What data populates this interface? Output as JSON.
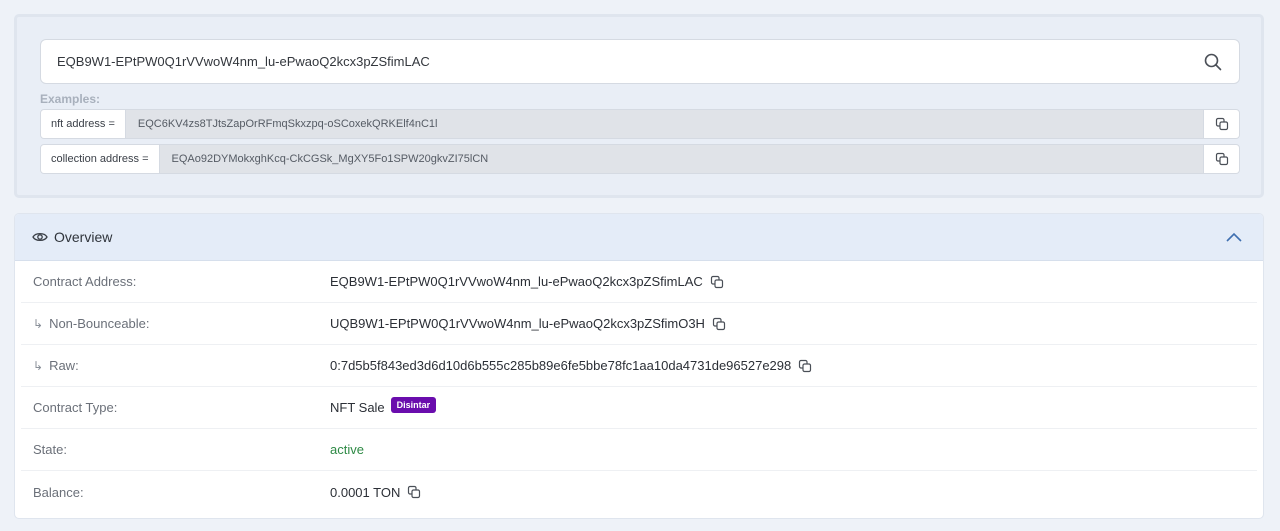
{
  "search": {
    "value": "EQB9W1-EPtPW0Q1rVVwoW4nm_lu-ePwaoQ2kcx3pZSfimLAC",
    "icon": "search-icon"
  },
  "examples": {
    "label": "Examples:",
    "items": [
      {
        "prefix": "nft address =",
        "value": "EQC6KV4zs8TJtsZapOrRFmqSkxzpq-oSCoxekQRKElf4nC1l"
      },
      {
        "prefix": "collection address =",
        "value": "EQAo92DYMokxghKcq-CkCGSk_MgXY5Fo1SPW20gkvZI75lCN"
      }
    ]
  },
  "overview": {
    "title": "Overview",
    "rows": {
      "contract_address": {
        "label": "Contract Address:",
        "value": "EQB9W1-EPtPW0Q1rVVwoW4nm_lu-ePwaoQ2kcx3pZSfimLAC"
      },
      "non_bounceable": {
        "label": "Non-Bounceable:",
        "value": "UQB9W1-EPtPW0Q1rVVwoW4nm_lu-ePwaoQ2kcx3pZSfimO3H"
      },
      "raw": {
        "label": "Raw:",
        "value": "0:7d5b5f843ed3d6d10d6b555c285b89e6fe5bbe78fc1aa10da4731de96527e298"
      },
      "contract_type": {
        "label": "Contract Type:",
        "value": "NFT Sale",
        "badge": "Disintar"
      },
      "state": {
        "label": "State:",
        "value": "active"
      },
      "balance": {
        "label": "Balance:",
        "value": "0.0001 TON"
      }
    }
  },
  "colors": {
    "badge": "#6a0dad",
    "state_active": "#2e8a45",
    "header_bg": "#e4ecf8"
  }
}
